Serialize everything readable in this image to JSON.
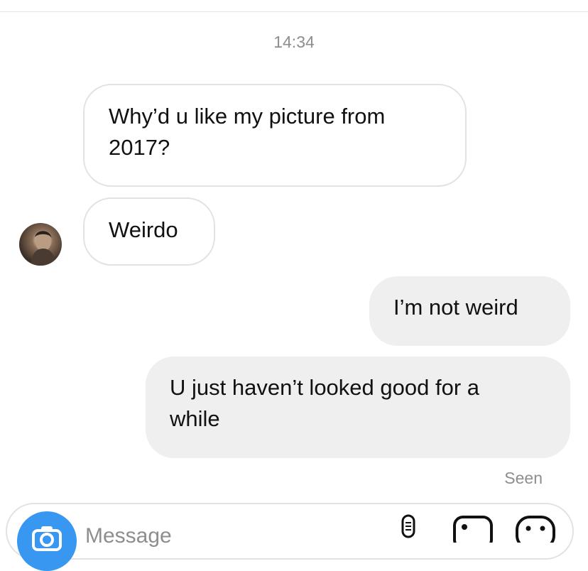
{
  "header": {
    "timestamp": "14:34"
  },
  "messages": [
    {
      "direction": "incoming",
      "text_line1": "Why’d u like my picture from",
      "text_line2": "2017?"
    },
    {
      "direction": "incoming",
      "text": "Weirdo"
    },
    {
      "direction": "outgoing",
      "text": "I’m not weird"
    },
    {
      "direction": "outgoing",
      "text_line1": "U just haven’t looked good for a",
      "text_line2": "while"
    }
  ],
  "status": {
    "seen": "Seen"
  },
  "composer": {
    "placeholder": "Message",
    "icons": [
      "camera-icon",
      "microphone-icon",
      "gallery-icon",
      "sticker-icon"
    ]
  },
  "colors": {
    "outgoing_bubble": "#efefef",
    "camera_button": "#3897f0",
    "meta_text": "#8e8e8e"
  }
}
